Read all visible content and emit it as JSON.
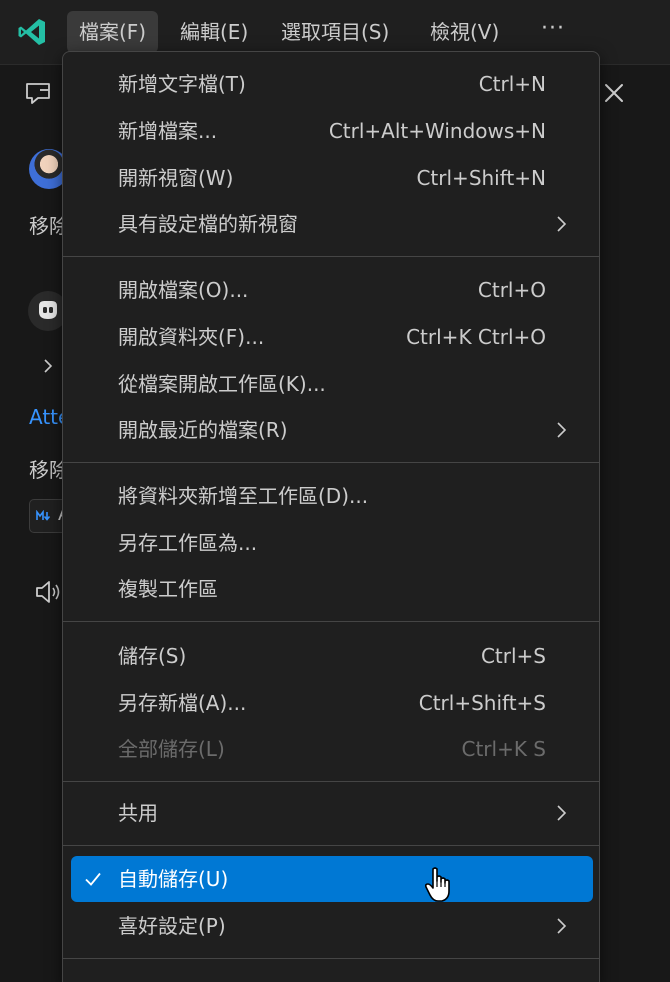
{
  "menubar": {
    "logo_icon": "vscode-insiders-logo-icon",
    "items": [
      {
        "label": "檔案(F)",
        "active": true
      },
      {
        "label": "編輯(E)",
        "active": false
      },
      {
        "label": "選取項目(S)",
        "active": false
      },
      {
        "label": "檢視(V)",
        "active": false
      }
    ],
    "more_label": "···"
  },
  "background": {
    "text_1": "移除",
    "link_text": "Atte",
    "text_2": "移除",
    "chip_text": "A"
  },
  "file_menu": {
    "items": [
      {
        "label": "新增文字檔(T)",
        "shortcut": "Ctrl+N"
      },
      {
        "label": "新增檔案...",
        "shortcut": "Ctrl+Alt+Windows+N"
      },
      {
        "label": "開新視窗(W)",
        "shortcut": "Ctrl+Shift+N"
      },
      {
        "label": "具有設定檔的新視窗",
        "submenu": true
      },
      {
        "label": "開啟檔案(O)...",
        "shortcut": "Ctrl+O"
      },
      {
        "label": "開啟資料夾(F)...",
        "shortcut": "Ctrl+K Ctrl+O"
      },
      {
        "label": "從檔案開啟工作區(K)..."
      },
      {
        "label": "開啟最近的檔案(R)",
        "submenu": true
      },
      {
        "label": "將資料夾新增至工作區(D)..."
      },
      {
        "label": "另存工作區為..."
      },
      {
        "label": "複製工作區"
      },
      {
        "label": "儲存(S)",
        "shortcut": "Ctrl+S"
      },
      {
        "label": "另存新檔(A)...",
        "shortcut": "Ctrl+Shift+S"
      },
      {
        "label": "全部儲存(L)",
        "shortcut": "Ctrl+K S",
        "disabled": true
      },
      {
        "label": "共用",
        "submenu": true
      },
      {
        "label": "自動儲存(U)",
        "checked": true,
        "selected": true
      },
      {
        "label": "喜好設定(P)",
        "submenu": true
      }
    ]
  },
  "colors": {
    "accent": "#0078d4",
    "link": "#3794ff",
    "logo": "#24bfa5"
  }
}
